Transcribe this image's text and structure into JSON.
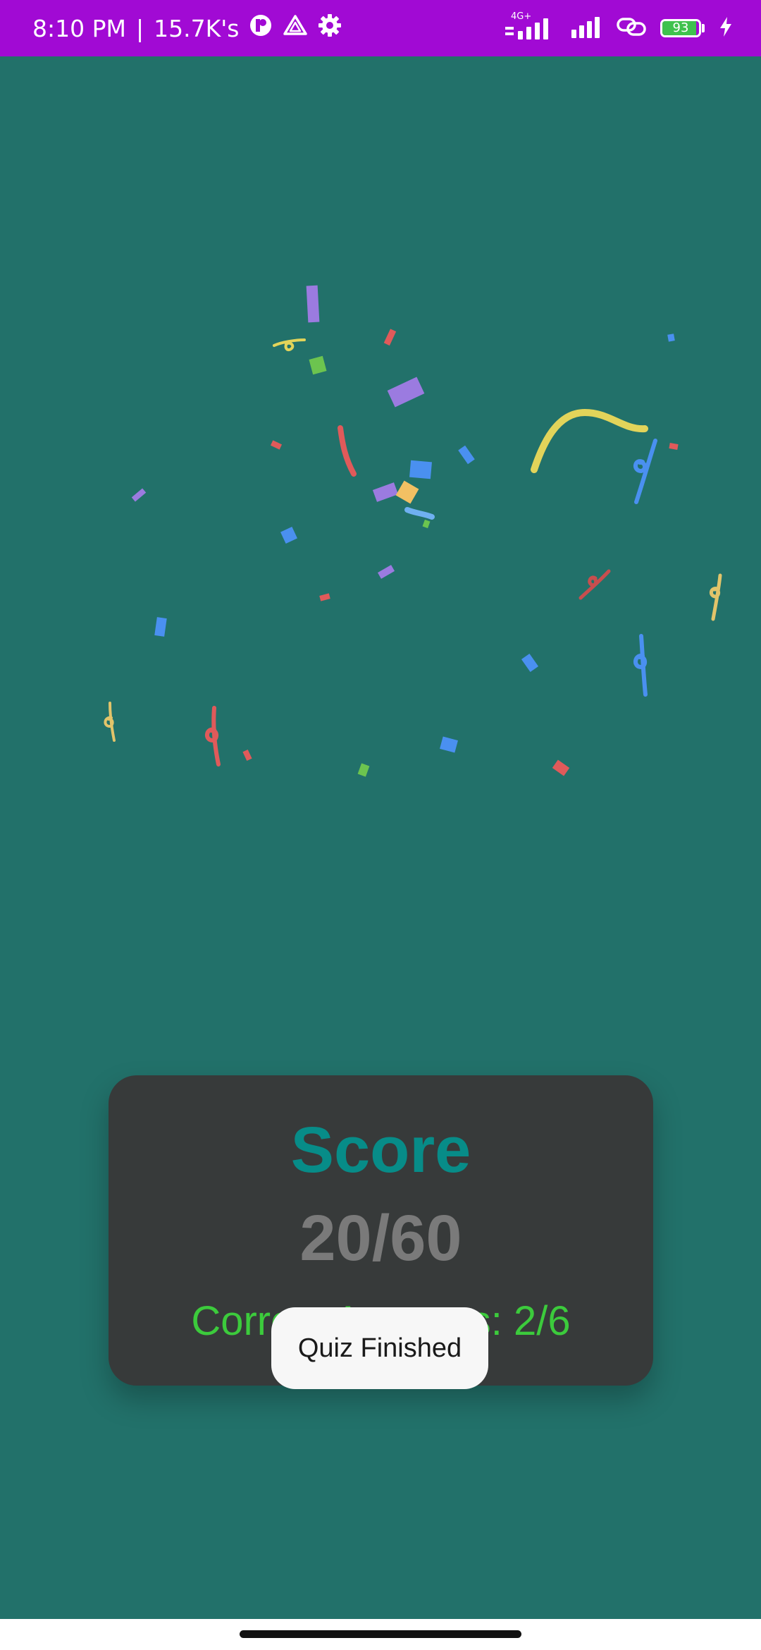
{
  "status_bar": {
    "time": "8:10 PM",
    "separator": "|",
    "data_speed": "15.7K's",
    "network_label": "4G+",
    "battery_level": "93",
    "battery_fraction": 0.93,
    "icons": [
      "app-notification-icon",
      "drive-icon",
      "settings-gear-icon",
      "signal-4g-icon",
      "signal-icon",
      "link-icon",
      "battery-icon",
      "charging-bolt-icon"
    ],
    "background_color": "#A10AD4"
  },
  "screen": {
    "background_color": "#22716A"
  },
  "score_card": {
    "title": "Score",
    "score": "20/60",
    "correct_answers": "Correct Answers: 2/6",
    "title_color": "#078C88",
    "score_color": "#7A7A7A",
    "correct_color": "#3CCB3C",
    "card_color": "#373A3A"
  },
  "toast": {
    "message": "Quiz Finished"
  },
  "confetti": {
    "colors": [
      "#9B7BE0",
      "#4A90F0",
      "#E2D45A",
      "#E05A5A",
      "#6CC44F",
      "#F2C063",
      "#6FB0F0"
    ]
  }
}
